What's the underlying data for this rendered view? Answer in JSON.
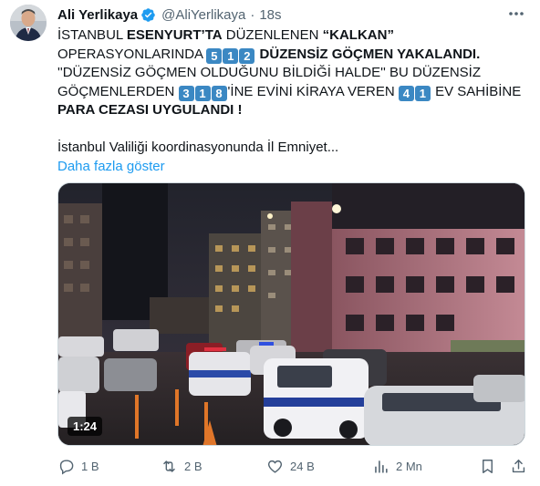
{
  "author": {
    "name": "Ali Yerlikaya",
    "handle": "@AliYerlikaya",
    "separator": "·",
    "time": "18s"
  },
  "tweet": {
    "line1_a": "İSTANBUL ",
    "line1_b": "ESENYURT’TA",
    "line1_c": " DÜZENLENEN ",
    "line1_d": "“KALKAN”",
    "line2_a": "OPERASYONLARINDA ",
    "line2_digits": [
      "5",
      "1",
      "2"
    ],
    "line2_b": " DÜZENSİZ GÖÇMEN YAKALANDI.",
    "line3": "''DÜZENSİZ GÖÇMEN OLDUĞUNU BİLDİĞİ HALDE'' BU DÜZENSİZ",
    "line4_a": "GÖÇMENLERDEN ",
    "line4_digits1": [
      "3",
      "1",
      "8"
    ],
    "line4_b": "'İNE EVİNİ KİRAYA VEREN ",
    "line4_digits2": [
      "4",
      "1"
    ],
    "line4_c": " EV SAHİBİNE",
    "line5": "PARA CEZASI UYGULANDI !",
    "line6": "İstanbul Valiliği koordinasyonunda İl Emniyet...",
    "show_more": "Daha fazla göster"
  },
  "media": {
    "duration": "1:24"
  },
  "actions": {
    "replies": "1 B",
    "reposts": "2 B",
    "likes": "24 B",
    "views": "2 Mn"
  },
  "colors": {
    "accent": "#1d9bf0",
    "keycap": "#3b88c3",
    "muted": "#536471"
  }
}
